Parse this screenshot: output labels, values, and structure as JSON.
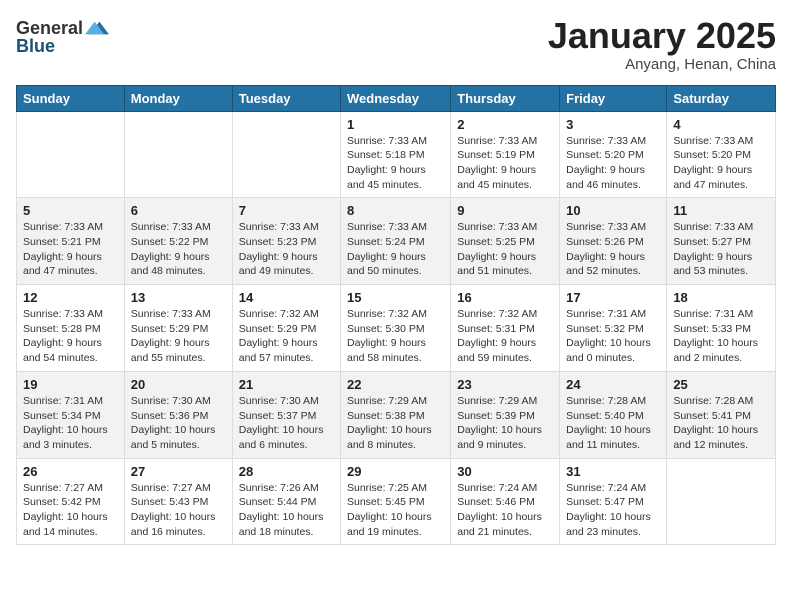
{
  "logo": {
    "line1": "General",
    "line2": "Blue"
  },
  "title": "January 2025",
  "subtitle": "Anyang, Henan, China",
  "days_header": [
    "Sunday",
    "Monday",
    "Tuesday",
    "Wednesday",
    "Thursday",
    "Friday",
    "Saturday"
  ],
  "weeks": [
    [
      {
        "day": "",
        "info": ""
      },
      {
        "day": "",
        "info": ""
      },
      {
        "day": "",
        "info": ""
      },
      {
        "day": "1",
        "info": "Sunrise: 7:33 AM\nSunset: 5:18 PM\nDaylight: 9 hours\nand 45 minutes."
      },
      {
        "day": "2",
        "info": "Sunrise: 7:33 AM\nSunset: 5:19 PM\nDaylight: 9 hours\nand 45 minutes."
      },
      {
        "day": "3",
        "info": "Sunrise: 7:33 AM\nSunset: 5:20 PM\nDaylight: 9 hours\nand 46 minutes."
      },
      {
        "day": "4",
        "info": "Sunrise: 7:33 AM\nSunset: 5:20 PM\nDaylight: 9 hours\nand 47 minutes."
      }
    ],
    [
      {
        "day": "5",
        "info": "Sunrise: 7:33 AM\nSunset: 5:21 PM\nDaylight: 9 hours\nand 47 minutes."
      },
      {
        "day": "6",
        "info": "Sunrise: 7:33 AM\nSunset: 5:22 PM\nDaylight: 9 hours\nand 48 minutes."
      },
      {
        "day": "7",
        "info": "Sunrise: 7:33 AM\nSunset: 5:23 PM\nDaylight: 9 hours\nand 49 minutes."
      },
      {
        "day": "8",
        "info": "Sunrise: 7:33 AM\nSunset: 5:24 PM\nDaylight: 9 hours\nand 50 minutes."
      },
      {
        "day": "9",
        "info": "Sunrise: 7:33 AM\nSunset: 5:25 PM\nDaylight: 9 hours\nand 51 minutes."
      },
      {
        "day": "10",
        "info": "Sunrise: 7:33 AM\nSunset: 5:26 PM\nDaylight: 9 hours\nand 52 minutes."
      },
      {
        "day": "11",
        "info": "Sunrise: 7:33 AM\nSunset: 5:27 PM\nDaylight: 9 hours\nand 53 minutes."
      }
    ],
    [
      {
        "day": "12",
        "info": "Sunrise: 7:33 AM\nSunset: 5:28 PM\nDaylight: 9 hours\nand 54 minutes."
      },
      {
        "day": "13",
        "info": "Sunrise: 7:33 AM\nSunset: 5:29 PM\nDaylight: 9 hours\nand 55 minutes."
      },
      {
        "day": "14",
        "info": "Sunrise: 7:32 AM\nSunset: 5:29 PM\nDaylight: 9 hours\nand 57 minutes."
      },
      {
        "day": "15",
        "info": "Sunrise: 7:32 AM\nSunset: 5:30 PM\nDaylight: 9 hours\nand 58 minutes."
      },
      {
        "day": "16",
        "info": "Sunrise: 7:32 AM\nSunset: 5:31 PM\nDaylight: 9 hours\nand 59 minutes."
      },
      {
        "day": "17",
        "info": "Sunrise: 7:31 AM\nSunset: 5:32 PM\nDaylight: 10 hours\nand 0 minutes."
      },
      {
        "day": "18",
        "info": "Sunrise: 7:31 AM\nSunset: 5:33 PM\nDaylight: 10 hours\nand 2 minutes."
      }
    ],
    [
      {
        "day": "19",
        "info": "Sunrise: 7:31 AM\nSunset: 5:34 PM\nDaylight: 10 hours\nand 3 minutes."
      },
      {
        "day": "20",
        "info": "Sunrise: 7:30 AM\nSunset: 5:36 PM\nDaylight: 10 hours\nand 5 minutes."
      },
      {
        "day": "21",
        "info": "Sunrise: 7:30 AM\nSunset: 5:37 PM\nDaylight: 10 hours\nand 6 minutes."
      },
      {
        "day": "22",
        "info": "Sunrise: 7:29 AM\nSunset: 5:38 PM\nDaylight: 10 hours\nand 8 minutes."
      },
      {
        "day": "23",
        "info": "Sunrise: 7:29 AM\nSunset: 5:39 PM\nDaylight: 10 hours\nand 9 minutes."
      },
      {
        "day": "24",
        "info": "Sunrise: 7:28 AM\nSunset: 5:40 PM\nDaylight: 10 hours\nand 11 minutes."
      },
      {
        "day": "25",
        "info": "Sunrise: 7:28 AM\nSunset: 5:41 PM\nDaylight: 10 hours\nand 12 minutes."
      }
    ],
    [
      {
        "day": "26",
        "info": "Sunrise: 7:27 AM\nSunset: 5:42 PM\nDaylight: 10 hours\nand 14 minutes."
      },
      {
        "day": "27",
        "info": "Sunrise: 7:27 AM\nSunset: 5:43 PM\nDaylight: 10 hours\nand 16 minutes."
      },
      {
        "day": "28",
        "info": "Sunrise: 7:26 AM\nSunset: 5:44 PM\nDaylight: 10 hours\nand 18 minutes."
      },
      {
        "day": "29",
        "info": "Sunrise: 7:25 AM\nSunset: 5:45 PM\nDaylight: 10 hours\nand 19 minutes."
      },
      {
        "day": "30",
        "info": "Sunrise: 7:24 AM\nSunset: 5:46 PM\nDaylight: 10 hours\nand 21 minutes."
      },
      {
        "day": "31",
        "info": "Sunrise: 7:24 AM\nSunset: 5:47 PM\nDaylight: 10 hours\nand 23 minutes."
      },
      {
        "day": "",
        "info": ""
      }
    ]
  ]
}
